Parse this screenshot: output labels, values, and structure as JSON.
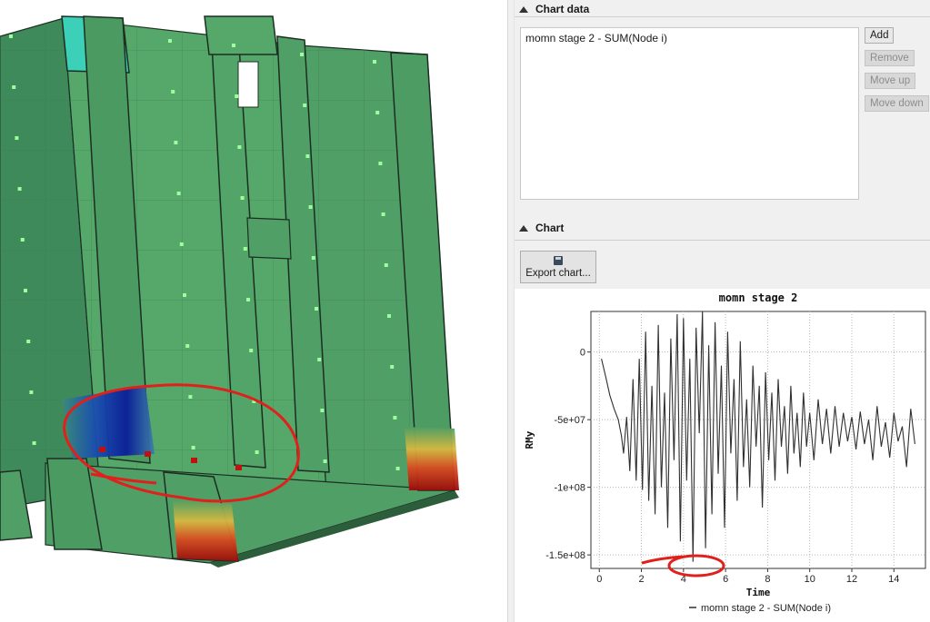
{
  "panel": {
    "chart_data_header": "Chart data",
    "chart_header": "Chart",
    "series_list": [
      "momn stage 2 - SUM(Node i)"
    ],
    "buttons": {
      "add": "Add",
      "remove": "Remove",
      "move_up": "Move up",
      "move_down": "Move down",
      "export": "Export chart..."
    }
  },
  "colors": {
    "panel_bg": "#f0f0f0",
    "series_line": "#303030",
    "annotation": "#e0201c",
    "element_green": "#4e9e64"
  },
  "chart_data": {
    "type": "line",
    "title": "momn stage 2",
    "xlabel": "Time",
    "ylabel": "RMy",
    "xlim": [
      -0.4,
      15.5
    ],
    "ylim": [
      -160000000,
      30000000
    ],
    "xticks": [
      0,
      2,
      4,
      6,
      8,
      10,
      12,
      14
    ],
    "yticks": [
      0,
      -50000000,
      -100000000,
      -150000000
    ],
    "ytick_labels": [
      "0",
      "-5e+07",
      "-1e+08",
      "-1.5e+08"
    ],
    "grid": true,
    "legend": "bottom-center",
    "series": [
      {
        "name": "momn stage 2 - SUM(Node i)",
        "x": [
          0.1,
          0.3,
          0.5,
          0.7,
          0.9,
          1.05,
          1.15,
          1.3,
          1.45,
          1.6,
          1.75,
          1.9,
          2.05,
          2.2,
          2.35,
          2.5,
          2.65,
          2.8,
          2.95,
          3.1,
          3.25,
          3.4,
          3.55,
          3.7,
          3.85,
          4.0,
          4.15,
          4.3,
          4.45,
          4.6,
          4.75,
          4.9,
          5.05,
          5.2,
          5.35,
          5.5,
          5.65,
          5.8,
          5.95,
          6.1,
          6.25,
          6.4,
          6.55,
          6.7,
          6.85,
          7.0,
          7.15,
          7.3,
          7.45,
          7.6,
          7.75,
          7.9,
          8.05,
          8.2,
          8.35,
          8.5,
          8.65,
          8.8,
          8.95,
          9.1,
          9.25,
          9.4,
          9.55,
          9.7,
          9.85,
          10.0,
          10.2,
          10.4,
          10.6,
          10.8,
          11.0,
          11.2,
          11.4,
          11.6,
          11.8,
          12.0,
          12.2,
          12.4,
          12.6,
          12.8,
          13.0,
          13.2,
          13.4,
          13.6,
          13.8,
          14.0,
          14.2,
          14.4,
          14.6,
          14.8,
          15.0
        ],
        "values": [
          -5000000,
          -18000000,
          -32000000,
          -42000000,
          -50000000,
          -62000000,
          -75000000,
          -48000000,
          -88000000,
          -20000000,
          -95000000,
          -5000000,
          -102000000,
          15000000,
          -110000000,
          -25000000,
          -120000000,
          20000000,
          -100000000,
          -30000000,
          -130000000,
          10000000,
          -80000000,
          28000000,
          -140000000,
          25000000,
          -95000000,
          -5000000,
          -155000000,
          18000000,
          -60000000,
          30000000,
          -145000000,
          5000000,
          -120000000,
          22000000,
          -90000000,
          -10000000,
          -130000000,
          15000000,
          -75000000,
          -20000000,
          -110000000,
          8000000,
          -85000000,
          -35000000,
          -100000000,
          -10000000,
          -70000000,
          -25000000,
          -115000000,
          -15000000,
          -80000000,
          -30000000,
          -95000000,
          -20000000,
          -70000000,
          -40000000,
          -90000000,
          -25000000,
          -75000000,
          -45000000,
          -85000000,
          -30000000,
          -70000000,
          -45000000,
          -80000000,
          -35000000,
          -68000000,
          -42000000,
          -75000000,
          -40000000,
          -70000000,
          -45000000,
          -66000000,
          -48000000,
          -72000000,
          -44000000,
          -68000000,
          -50000000,
          -80000000,
          -40000000,
          -70000000,
          -52000000,
          -78000000,
          -45000000,
          -66000000,
          -55000000,
          -85000000,
          -42000000,
          -68000000
        ]
      }
    ]
  }
}
